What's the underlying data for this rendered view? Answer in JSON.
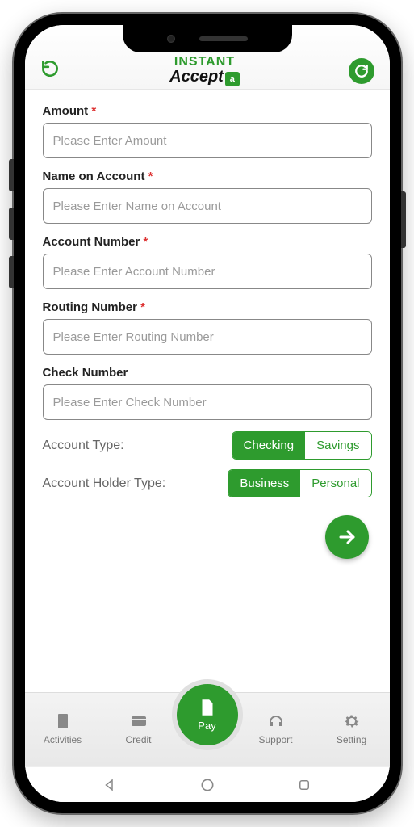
{
  "colors": {
    "accent": "#2e9b2e"
  },
  "header": {
    "logo_line1": "INSTANT",
    "logo_line2": "Accept",
    "logo_badge": "a"
  },
  "form": {
    "amount": {
      "label": "Amount",
      "required": true,
      "placeholder": "Please Enter Amount"
    },
    "name_on_account": {
      "label": "Name on Account",
      "required": true,
      "placeholder": "Please Enter Name on Account"
    },
    "account_number": {
      "label": "Account Number",
      "required": true,
      "placeholder": "Please Enter Account Number"
    },
    "routing_number": {
      "label": "Routing Number",
      "required": true,
      "placeholder": "Please Enter Routing Number"
    },
    "check_number": {
      "label": "Check Number",
      "required": false,
      "placeholder": "Please Enter Check Number"
    }
  },
  "account_type": {
    "label": "Account Type:",
    "options": [
      "Checking",
      "Savings"
    ],
    "selected": "Checking"
  },
  "holder_type": {
    "label": "Account Holder Type:",
    "options": [
      "Business",
      "Personal"
    ],
    "selected": "Business"
  },
  "tabs": {
    "activities": "Activities",
    "credit": "Credit",
    "pay": "Pay",
    "support": "Support",
    "setting": "Setting"
  },
  "required_marker": "*"
}
